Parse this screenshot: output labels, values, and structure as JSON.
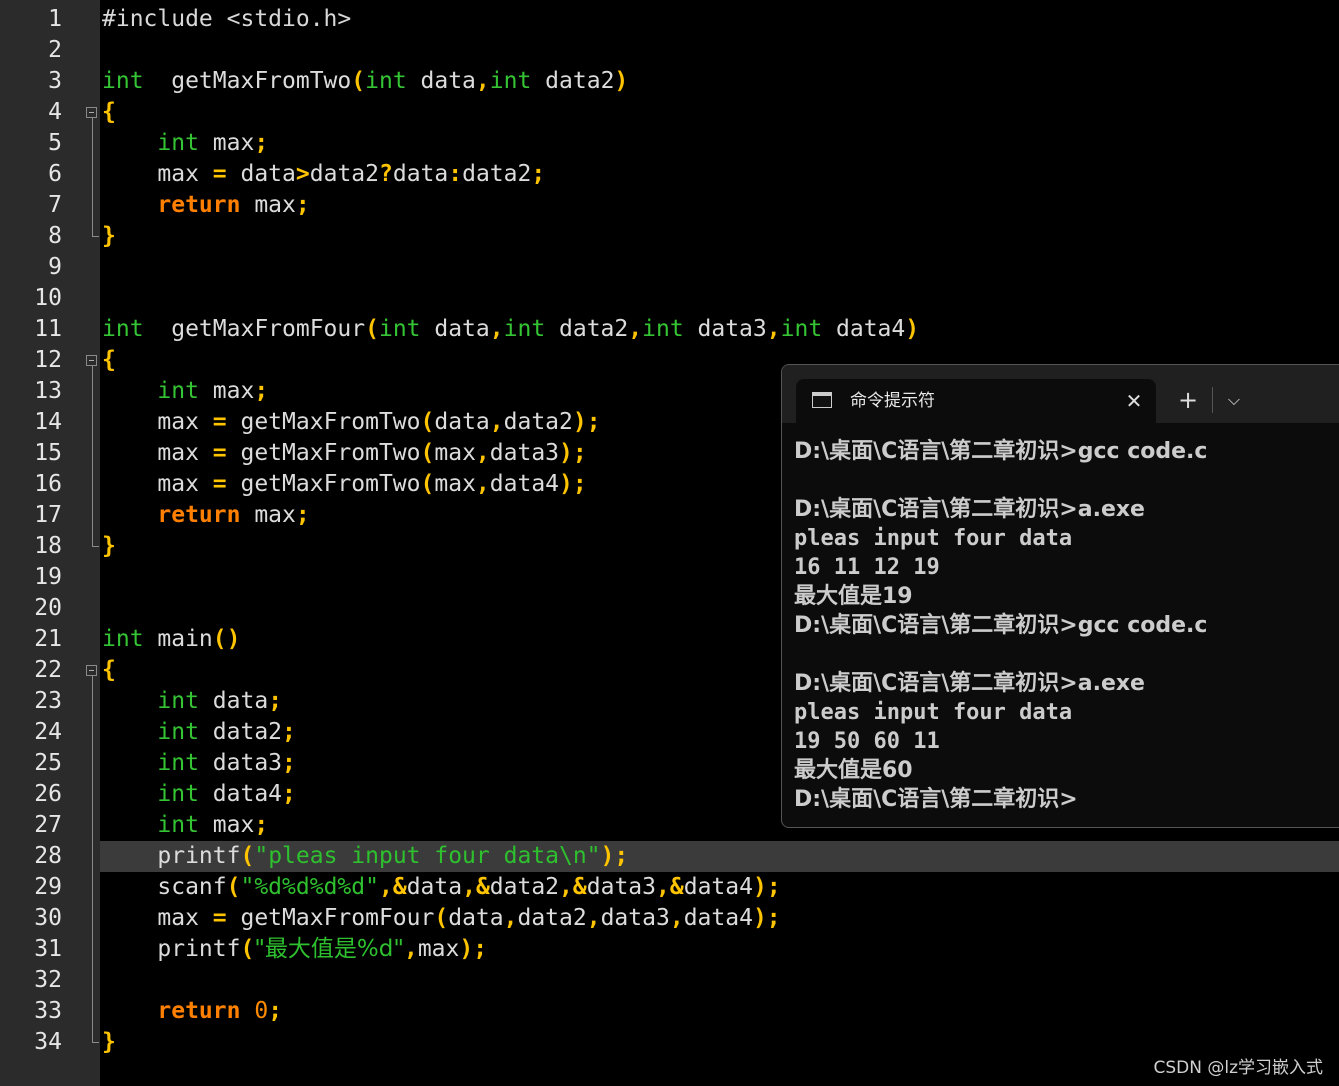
{
  "editor": {
    "line_numbers": [
      "1",
      "2",
      "3",
      "4",
      "5",
      "6",
      "7",
      "8",
      "9",
      "10",
      "11",
      "12",
      "13",
      "14",
      "15",
      "16",
      "17",
      "18",
      "19",
      "20",
      "21",
      "22",
      "23",
      "24",
      "25",
      "26",
      "27",
      "28",
      "29",
      "30",
      "31",
      "32",
      "33",
      "34"
    ],
    "lines": [
      [
        [
          "pp",
          "#include <stdio.h>"
        ]
      ],
      [],
      [
        [
          "kw",
          "int"
        ],
        [
          "",
          "  getMaxFromTwo"
        ],
        [
          "op",
          "("
        ],
        [
          "kw",
          "int"
        ],
        [
          "",
          " data"
        ],
        [
          "op",
          ","
        ],
        [
          "kw",
          "int"
        ],
        [
          "",
          " data2"
        ],
        [
          "op",
          ")"
        ]
      ],
      [
        [
          "op",
          "{"
        ]
      ],
      [
        [
          "",
          "    "
        ],
        [
          "kw",
          "int"
        ],
        [
          "",
          " max"
        ],
        [
          "op",
          ";"
        ]
      ],
      [
        [
          "",
          "    max "
        ],
        [
          "op",
          "="
        ],
        [
          "",
          " data"
        ],
        [
          "op",
          ">"
        ],
        [
          "",
          "data2"
        ],
        [
          "op",
          "?"
        ],
        [
          "",
          "data"
        ],
        [
          "op",
          ":"
        ],
        [
          "",
          "data2"
        ],
        [
          "op",
          ";"
        ]
      ],
      [
        [
          "",
          "    "
        ],
        [
          "ret",
          "return"
        ],
        [
          "",
          " max"
        ],
        [
          "op",
          ";"
        ]
      ],
      [
        [
          "op",
          "}"
        ]
      ],
      [],
      [],
      [
        [
          "kw",
          "int"
        ],
        [
          "",
          "  getMaxFromFour"
        ],
        [
          "op",
          "("
        ],
        [
          "kw",
          "int"
        ],
        [
          "",
          " data"
        ],
        [
          "op",
          ","
        ],
        [
          "kw",
          "int"
        ],
        [
          "",
          " data2"
        ],
        [
          "op",
          ","
        ],
        [
          "kw",
          "int"
        ],
        [
          "",
          " data3"
        ],
        [
          "op",
          ","
        ],
        [
          "kw",
          "int"
        ],
        [
          "",
          " data4"
        ],
        [
          "op",
          ")"
        ]
      ],
      [
        [
          "op",
          "{"
        ]
      ],
      [
        [
          "",
          "    "
        ],
        [
          "kw",
          "int"
        ],
        [
          "",
          " max"
        ],
        [
          "op",
          ";"
        ]
      ],
      [
        [
          "",
          "    max "
        ],
        [
          "op",
          "="
        ],
        [
          "",
          " getMaxFromTwo"
        ],
        [
          "op",
          "("
        ],
        [
          "",
          "data"
        ],
        [
          "op",
          ","
        ],
        [
          "",
          "data2"
        ],
        [
          "op",
          ")"
        ],
        [
          "op",
          ";"
        ]
      ],
      [
        [
          "",
          "    max "
        ],
        [
          "op",
          "="
        ],
        [
          "",
          " getMaxFromTwo"
        ],
        [
          "op",
          "("
        ],
        [
          "",
          "max"
        ],
        [
          "op",
          ","
        ],
        [
          "",
          "data3"
        ],
        [
          "op",
          ")"
        ],
        [
          "op",
          ";"
        ]
      ],
      [
        [
          "",
          "    max "
        ],
        [
          "op",
          "="
        ],
        [
          "",
          " getMaxFromTwo"
        ],
        [
          "op",
          "("
        ],
        [
          "",
          "max"
        ],
        [
          "op",
          ","
        ],
        [
          "",
          "data4"
        ],
        [
          "op",
          ")"
        ],
        [
          "op",
          ";"
        ]
      ],
      [
        [
          "",
          "    "
        ],
        [
          "ret",
          "return"
        ],
        [
          "",
          " max"
        ],
        [
          "op",
          ";"
        ]
      ],
      [
        [
          "op",
          "}"
        ]
      ],
      [],
      [],
      [
        [
          "kw",
          "int"
        ],
        [
          "",
          " main"
        ],
        [
          "op",
          "()"
        ]
      ],
      [
        [
          "op",
          "{"
        ]
      ],
      [
        [
          "",
          "    "
        ],
        [
          "kw",
          "int"
        ],
        [
          "",
          " data"
        ],
        [
          "op",
          ";"
        ]
      ],
      [
        [
          "",
          "    "
        ],
        [
          "kw",
          "int"
        ],
        [
          "",
          " data2"
        ],
        [
          "op",
          ";"
        ]
      ],
      [
        [
          "",
          "    "
        ],
        [
          "kw",
          "int"
        ],
        [
          "",
          " data3"
        ],
        [
          "op",
          ";"
        ]
      ],
      [
        [
          "",
          "    "
        ],
        [
          "kw",
          "int"
        ],
        [
          "",
          " data4"
        ],
        [
          "op",
          ";"
        ]
      ],
      [
        [
          "",
          "    "
        ],
        [
          "kw",
          "int"
        ],
        [
          "",
          " max"
        ],
        [
          "op",
          ";"
        ]
      ],
      [
        [
          "",
          "    printf"
        ],
        [
          "op",
          "("
        ],
        [
          "str",
          "\"pleas input four data\\n\""
        ],
        [
          "op",
          ")"
        ],
        [
          "op",
          ";"
        ]
      ],
      [
        [
          "",
          "    scanf"
        ],
        [
          "op",
          "("
        ],
        [
          "str",
          "\"%d%d%d%d\""
        ],
        [
          "op",
          ","
        ],
        [
          "op",
          "&"
        ],
        [
          "",
          "data"
        ],
        [
          "op",
          ","
        ],
        [
          "op",
          "&"
        ],
        [
          "",
          "data2"
        ],
        [
          "op",
          ","
        ],
        [
          "op",
          "&"
        ],
        [
          "",
          "data3"
        ],
        [
          "op",
          ","
        ],
        [
          "op",
          "&"
        ],
        [
          "",
          "data4"
        ],
        [
          "op",
          ")"
        ],
        [
          "op",
          ";"
        ]
      ],
      [
        [
          "",
          "    max "
        ],
        [
          "op",
          "="
        ],
        [
          "",
          " getMaxFromFour"
        ],
        [
          "op",
          "("
        ],
        [
          "",
          "data"
        ],
        [
          "op",
          ","
        ],
        [
          "",
          "data2"
        ],
        [
          "op",
          ","
        ],
        [
          "",
          "data3"
        ],
        [
          "op",
          ","
        ],
        [
          "",
          "data4"
        ],
        [
          "op",
          ")"
        ],
        [
          "op",
          ";"
        ]
      ],
      [
        [
          "",
          "    printf"
        ],
        [
          "op",
          "("
        ],
        [
          "str",
          "\"最大值是%d\""
        ],
        [
          "op",
          ","
        ],
        [
          "",
          "max"
        ],
        [
          "op",
          ")"
        ],
        [
          "op",
          ";"
        ]
      ],
      [],
      [
        [
          "",
          "    "
        ],
        [
          "ret",
          "return"
        ],
        [
          "",
          " "
        ],
        [
          "num",
          "0"
        ],
        [
          "op",
          ";"
        ]
      ],
      [
        [
          "op",
          "}"
        ]
      ]
    ],
    "highlighted_line": 28
  },
  "terminal": {
    "tab_title": "命令提示符",
    "close_glyph": "✕",
    "new_tab_glyph": "+",
    "dropdown_glyph": "⌵",
    "lines": [
      "D:\\桌面\\C语言\\第二章初识>gcc code.c",
      "",
      "D:\\桌面\\C语言\\第二章初识>a.exe",
      "pleas input four data",
      "16 11 12 19",
      "最大值是19",
      "D:\\桌面\\C语言\\第二章初识>gcc code.c",
      "",
      "D:\\桌面\\C语言\\第二章初识>a.exe",
      "pleas input four data",
      "19 50 60 11",
      "最大值是60",
      "D:\\桌面\\C语言\\第二章初识>"
    ]
  },
  "watermark": "CSDN @lz学习嵌入式"
}
